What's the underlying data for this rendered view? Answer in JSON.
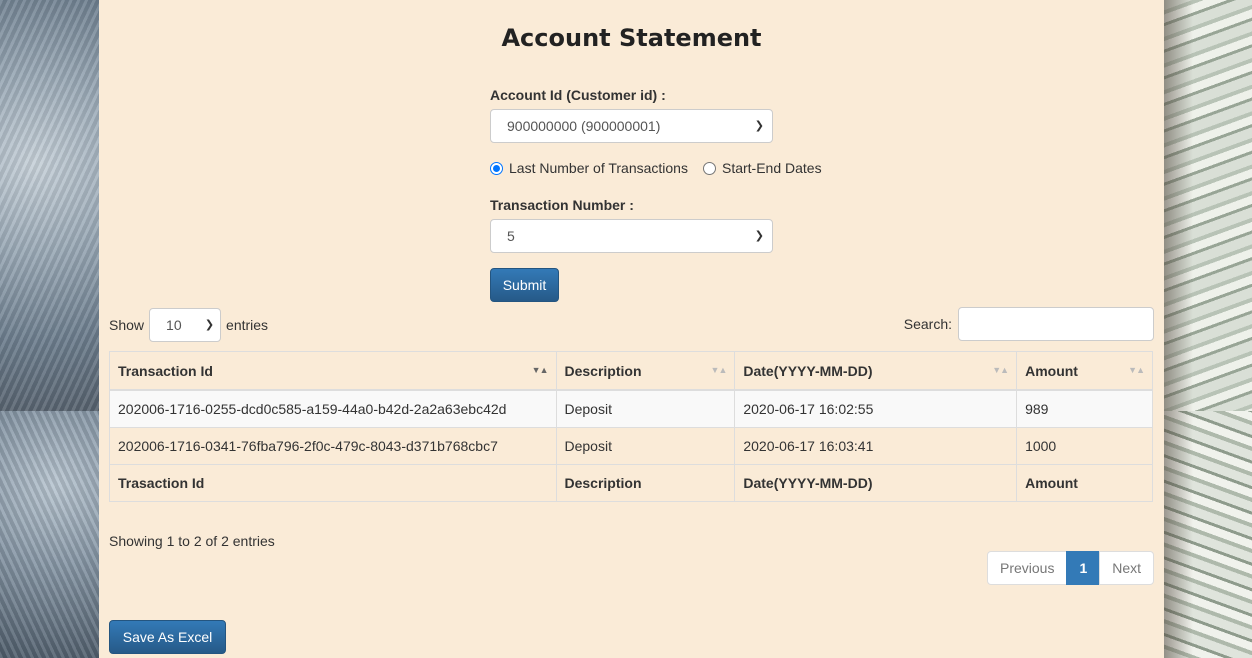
{
  "page": {
    "title": "Account Statement"
  },
  "form": {
    "account_label": "Account Id (Customer id) :",
    "account_value": "900000000 (900000001)",
    "radio_last_label": "Last Number of Transactions",
    "radio_dates_label": "Start-End Dates",
    "radio_selected": "last",
    "txn_number_label": "Transaction Number :",
    "txn_number_value": "5",
    "submit_label": "Submit"
  },
  "table_controls": {
    "show_label": "Show",
    "entries_value": "10",
    "entries_label": "entries",
    "search_label": "Search:",
    "search_value": ""
  },
  "table": {
    "columns": [
      "Transaction Id",
      "Description",
      "Date(YYYY-MM-DD)",
      "Amount"
    ],
    "rows": [
      [
        "202006-1716-0255-dcd0c585-a159-44a0-b42d-2a2a63ebc42d",
        "Deposit",
        "2020-06-17 16:02:55",
        "989"
      ],
      [
        "202006-1716-0341-76fba796-2f0c-479c-8043-d371b768cbc7",
        "Deposit",
        "2020-06-17 16:03:41",
        "1000"
      ]
    ],
    "footer": [
      "Trasaction Id",
      "Description",
      "Date(YYYY-MM-DD)",
      "Amount"
    ],
    "sort_column": "Transaction Id"
  },
  "pagination": {
    "info": "Showing 1 to 2 of 2 entries",
    "previous_label": "Previous",
    "current_page": "1",
    "next_label": "Next"
  },
  "actions": {
    "save_excel_label": "Save As Excel"
  },
  "colors": {
    "panel_background": "#faebd7",
    "primary_button": "#337ab7"
  }
}
